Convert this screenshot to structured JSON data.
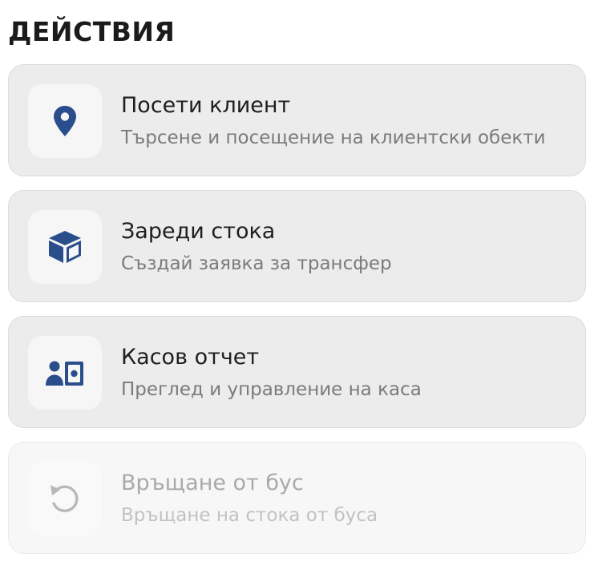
{
  "section": {
    "title": "ДЕЙСТВИЯ"
  },
  "colors": {
    "accent": "#2a4e8c",
    "disabled_icon": "#b8b8b8",
    "card_background": "#ececec",
    "icon_tile_background": "#f6f6f6"
  },
  "actions": [
    {
      "title": "Посети клиент",
      "subtitle": "Търсене и посещение на клиентски обекти",
      "icon": "location-pin-icon",
      "enabled": true
    },
    {
      "title": "Зареди стока",
      "subtitle": "Създай заявка за трансфер",
      "icon": "box-icon",
      "enabled": true
    },
    {
      "title": "Касов отчет",
      "subtitle": "Преглед и управление на каса",
      "icon": "person-cash-icon",
      "enabled": true
    },
    {
      "title": "Връщане от бус",
      "subtitle": "Връщане на стока от буса",
      "icon": "undo-icon",
      "enabled": false
    }
  ]
}
